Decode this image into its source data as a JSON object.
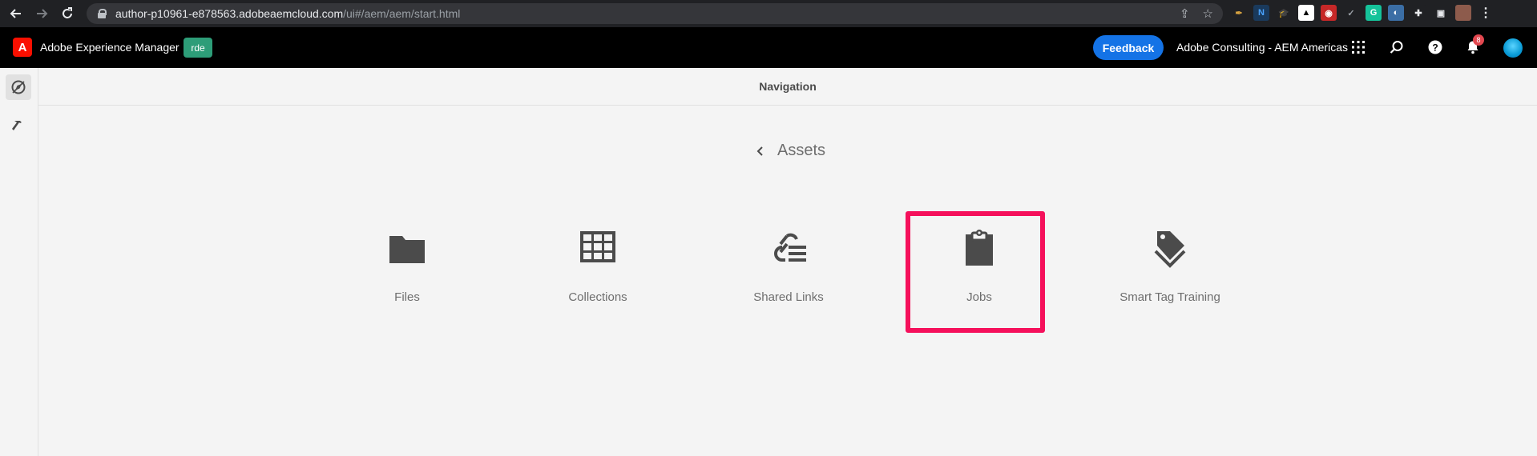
{
  "browser": {
    "url_host": "author-p10961-e878563.adobeaemcloud.com",
    "url_path": "/ui#/aem/aem/start.html"
  },
  "header": {
    "product_name": "Adobe Experience Manager",
    "env_badge": "rde",
    "feedback_label": "Feedback",
    "org_name": "Adobe Consulting - AEM Americas",
    "notification_count": "8"
  },
  "title_bar": {
    "title": "Navigation"
  },
  "breadcrumb": {
    "label": "Assets"
  },
  "cards": [
    {
      "label": "Files",
      "icon": "folder-icon"
    },
    {
      "label": "Collections",
      "icon": "grid-icon"
    },
    {
      "label": "Shared Links",
      "icon": "link-list-icon"
    },
    {
      "label": "Jobs",
      "icon": "clipboard-icon",
      "highlighted": true
    },
    {
      "label": "Smart Tag Training",
      "icon": "tag-icon"
    }
  ],
  "colors": {
    "highlight": "#f5105b",
    "feedback": "#1473e6",
    "env_badge": "#2d9d78",
    "adobe_red": "#fa0f00"
  }
}
